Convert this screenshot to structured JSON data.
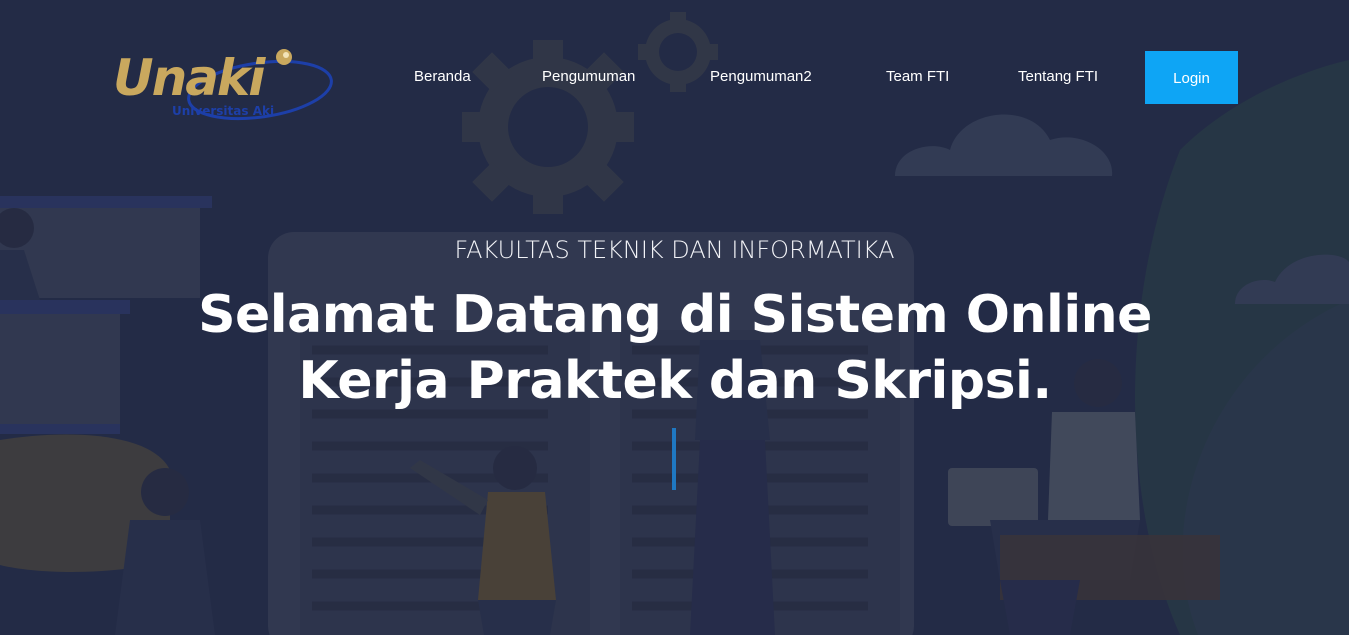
{
  "header": {
    "logo_text": "Unaki",
    "logo_subtext": "Universitas Aki"
  },
  "nav": {
    "items": [
      {
        "label": "Beranda"
      },
      {
        "label": "Pengumuman"
      },
      {
        "label": "Pengumuman2"
      },
      {
        "label": "Team FTI"
      },
      {
        "label": "Tentang FTI"
      }
    ],
    "login_label": "Login"
  },
  "hero": {
    "eyebrow": "FAKULTAS TEKNIK DAN INFORMATIKA",
    "title": "Selamat Datang di Sistem Online Kerja Praktek dan Skripsi."
  },
  "colors": {
    "background": "#262e4a",
    "accent": "#0ea5f5",
    "logo_gold": "#c9a85e",
    "logo_blue": "#1d3fa8"
  }
}
